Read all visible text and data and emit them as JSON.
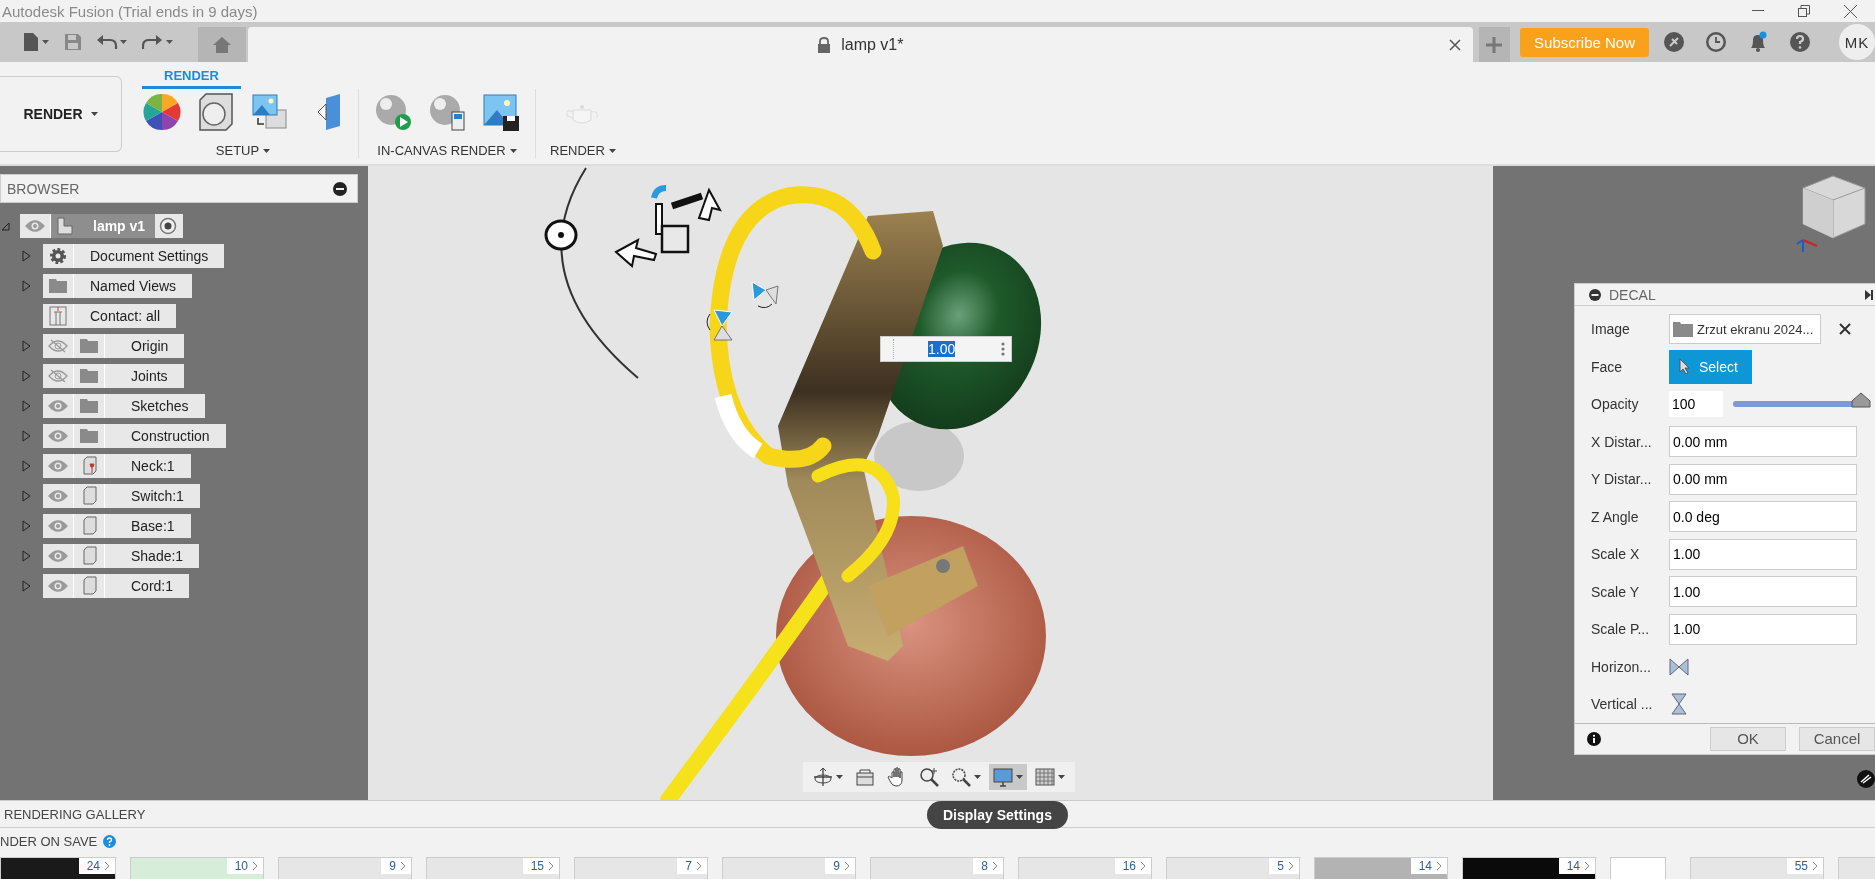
{
  "window": {
    "title": "Autodesk Fusion (Trial ends in 9 days)"
  },
  "document_tab": {
    "title": "lamp v1*",
    "locked": true
  },
  "subscribe_button": {
    "label": "Subscribe Now"
  },
  "notifications": {
    "unread": true
  },
  "user": {
    "initials": "MK"
  },
  "workspace": {
    "label": "RENDER"
  },
  "toolbar_tabs": [
    {
      "label": "RENDER",
      "selected": true
    }
  ],
  "tool_groups": [
    {
      "label": "SETUP",
      "tools": [
        {
          "kind": "color-wheel",
          "disabled": false
        },
        {
          "kind": "sphere-box",
          "disabled": false
        },
        {
          "kind": "image-box",
          "disabled": false
        },
        {
          "kind": "decal-plane",
          "disabled": false
        }
      ]
    },
    {
      "label": "IN-CANVAS RENDER",
      "tools": [
        {
          "kind": "sphere-play",
          "disabled": false
        },
        {
          "kind": "sphere-settings",
          "disabled": false
        },
        {
          "kind": "image-save",
          "disabled": false
        }
      ]
    },
    {
      "label": "RENDER",
      "tools": [
        {
          "kind": "teapot",
          "disabled": true
        }
      ]
    }
  ],
  "browser": {
    "title": "BROWSER",
    "root": {
      "label": "lamp v1",
      "expanded": true,
      "visible": true,
      "active": true,
      "children": [
        {
          "label": "Document Settings",
          "kind": "settings",
          "expandable": true
        },
        {
          "label": "Named Views",
          "kind": "folder",
          "expandable": true
        },
        {
          "label": "Contact: all",
          "kind": "contact",
          "expandable": false
        },
        {
          "label": "Origin",
          "kind": "folder",
          "expandable": true,
          "visible": false
        },
        {
          "label": "Joints",
          "kind": "folder",
          "expandable": true,
          "visible": false
        },
        {
          "label": "Sketches",
          "kind": "folder",
          "expandable": true,
          "visible": true
        },
        {
          "label": "Construction",
          "kind": "folder",
          "expandable": true,
          "visible": true
        },
        {
          "label": "Neck:1",
          "kind": "grounded-component",
          "expandable": true,
          "visible": true
        },
        {
          "label": "Switch:1",
          "kind": "component",
          "expandable": true,
          "visible": true
        },
        {
          "label": "Base:1",
          "kind": "component",
          "expandable": true,
          "visible": true
        },
        {
          "label": "Shade:1",
          "kind": "component",
          "expandable": true,
          "visible": true
        },
        {
          "label": "Cord:1",
          "kind": "component",
          "expandable": true,
          "visible": true
        }
      ]
    }
  },
  "canvas": {
    "value_input": {
      "value": "1.00"
    },
    "nav_tools": [
      {
        "kind": "orbit",
        "dropdown": true,
        "selected": false
      },
      {
        "kind": "look-at",
        "dropdown": false,
        "selected": false
      },
      {
        "kind": "pan",
        "dropdown": false,
        "selected": false
      },
      {
        "kind": "zoom",
        "dropdown": false,
        "selected": false
      },
      {
        "kind": "zoom-window",
        "dropdown": true,
        "selected": false
      },
      {
        "kind": "display",
        "dropdown": true,
        "selected": true
      },
      {
        "kind": "grid",
        "dropdown": true,
        "selected": false
      }
    ],
    "tooltip": {
      "text": "Display Settings"
    }
  },
  "decal": {
    "title": "DECAL",
    "rows": [
      {
        "kind": "file",
        "label": "Image",
        "value": "Zrzut ekranu 2024..."
      },
      {
        "kind": "select",
        "label": "Face",
        "button": "Select"
      },
      {
        "kind": "slider",
        "label": "Opacity",
        "value": "100",
        "level": 1
      },
      {
        "kind": "text",
        "label": "X Distar...",
        "value": "0.00 mm"
      },
      {
        "kind": "text",
        "label": "Y Distar...",
        "value": "0.00 mm"
      },
      {
        "kind": "text",
        "label": "Z Angle",
        "value": "0.0 deg"
      },
      {
        "kind": "text",
        "label": "Scale X",
        "value": "1.00"
      },
      {
        "kind": "text",
        "label": "Scale Y",
        "value": "1.00"
      },
      {
        "kind": "text",
        "label": "Scale P...",
        "value": "1.00"
      },
      {
        "kind": "flip-horizontal",
        "label": "Horizon..."
      },
      {
        "kind": "flip-vertical",
        "label": "Vertical ..."
      }
    ],
    "buttons": [
      {
        "label": "OK"
      },
      {
        "label": "Cancel"
      }
    ]
  },
  "gallery": {
    "title": "RENDERING GALLERY",
    "render_on_save": "NDER ON SAVE",
    "thumbnails": [
      {
        "count": "24",
        "color": "#1a1a1a"
      },
      {
        "count": "10",
        "color": "#d6edda"
      },
      {
        "count": "9",
        "color": "#e6e6e6"
      },
      {
        "count": "15",
        "color": "#e6e6e6"
      },
      {
        "count": "7",
        "color": "#e6e6e6"
      },
      {
        "count": "9",
        "color": "#e6e6e6"
      },
      {
        "count": "8",
        "color": "#e6e6e6"
      },
      {
        "count": "16",
        "color": "#e6e6e6"
      },
      {
        "count": "5",
        "color": "#e6e6e6"
      },
      {
        "count": "14",
        "color": "#b3b3b3"
      },
      {
        "count": "14",
        "color": "#0a0a0a"
      }
    ],
    "pinned": [
      {
        "count": "55",
        "color": "#e6e6e6"
      }
    ]
  }
}
